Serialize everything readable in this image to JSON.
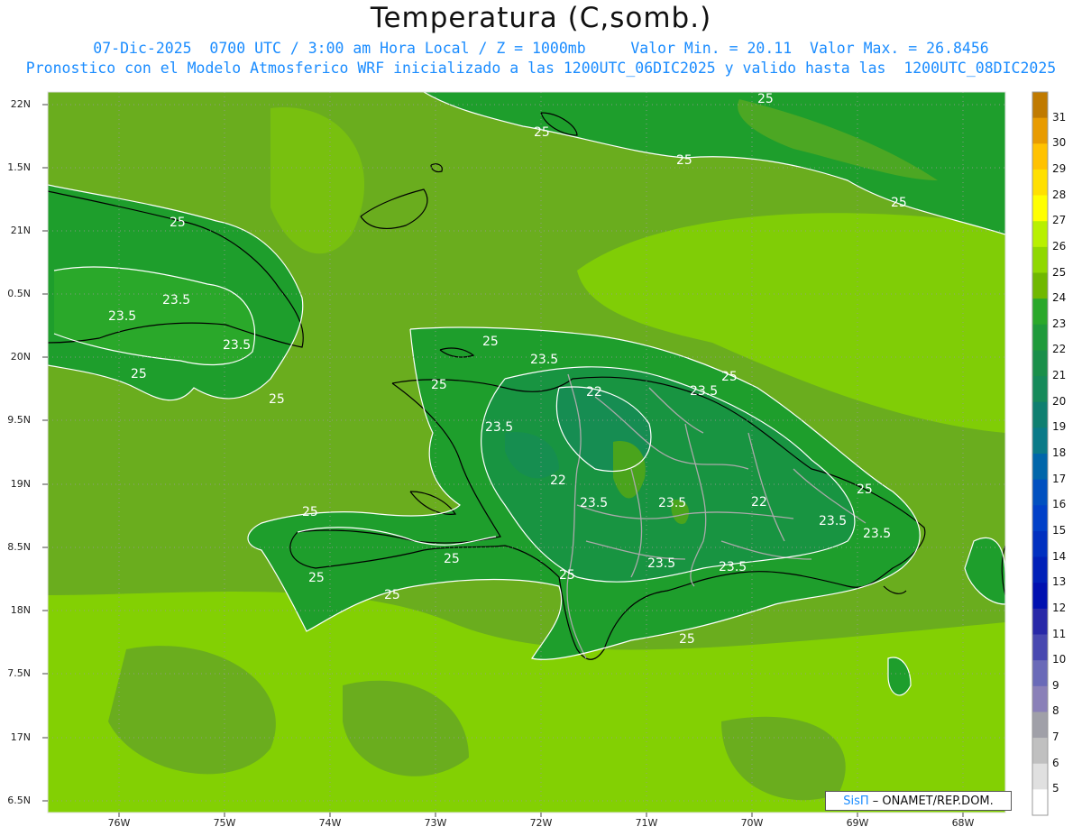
{
  "header": {
    "title": "Temperatura (C,somb.)",
    "line1": "07-Dic-2025  0700 UTC / 3:00 am Hora Local / Z = 1000mb     Valor Min. = 20.11  Valor Max. = 26.8456",
    "line2": "Pronostico con el Modelo Atmosferico WRF inicializado a las 1200UTC_06DIC2025 y valido hasta las  1200UTC_08DIC2025"
  },
  "axes": {
    "lat_labels": [
      "22N",
      "1.5N",
      "21N",
      "0.5N",
      "20N",
      "9.5N",
      "19N",
      "8.5N",
      "18N",
      "7.5N",
      "17N",
      "6.5N"
    ],
    "lon_labels": [
      "76W",
      "75W",
      "74W",
      "73W",
      "72W",
      "71W",
      "70W",
      "69W",
      "68W"
    ]
  },
  "contour_labels": [
    "25",
    "25",
    "25",
    "25",
    "25",
    "23.5",
    "23.5",
    "23.5",
    "25",
    "25",
    "25",
    "23.5",
    "25",
    "22",
    "23.5",
    "25",
    "23.5",
    "22",
    "23.5",
    "23.5",
    "22",
    "23.5",
    "25",
    "23.5",
    "25",
    "25",
    "25",
    "25",
    "23.5",
    "23.5",
    "25"
  ],
  "colorbar": {
    "labels": [
      "31",
      "30",
      "29",
      "28",
      "27",
      "26",
      "25",
      "24",
      "23",
      "22",
      "21",
      "20",
      "19",
      "18",
      "17",
      "16",
      "15",
      "14",
      "13",
      "12",
      "11",
      "10",
      "9",
      "8",
      "7",
      "6",
      "5"
    ],
    "colors": [
      "#c07a00",
      "#e89b00",
      "#ffc200",
      "#ffe000",
      "#ffff00",
      "#b8f000",
      "#90d800",
      "#70b800",
      "#2aa82a",
      "#1f9a3a",
      "#1a8f4a",
      "#168a5a",
      "#0f7f70",
      "#0a7a88",
      "#0066aa",
      "#0050c0",
      "#0040c8",
      "#0030c0",
      "#0020b8",
      "#0010b0",
      "#2828a8",
      "#4848b0",
      "#6a6ab8",
      "#8a80b8",
      "#a0a0a8",
      "#c0c0c0",
      "#e0e0e0",
      "#ffffff"
    ]
  },
  "credit": {
    "brand": "SisΠ",
    "text": " – ONAMET/REP.DOM."
  },
  "colors": {
    "sea": "#6aad1e",
    "sea_light": "#86d400",
    "land": "#1e9e2c",
    "land_dark": "#15904a",
    "inner": "#4aa41c"
  }
}
